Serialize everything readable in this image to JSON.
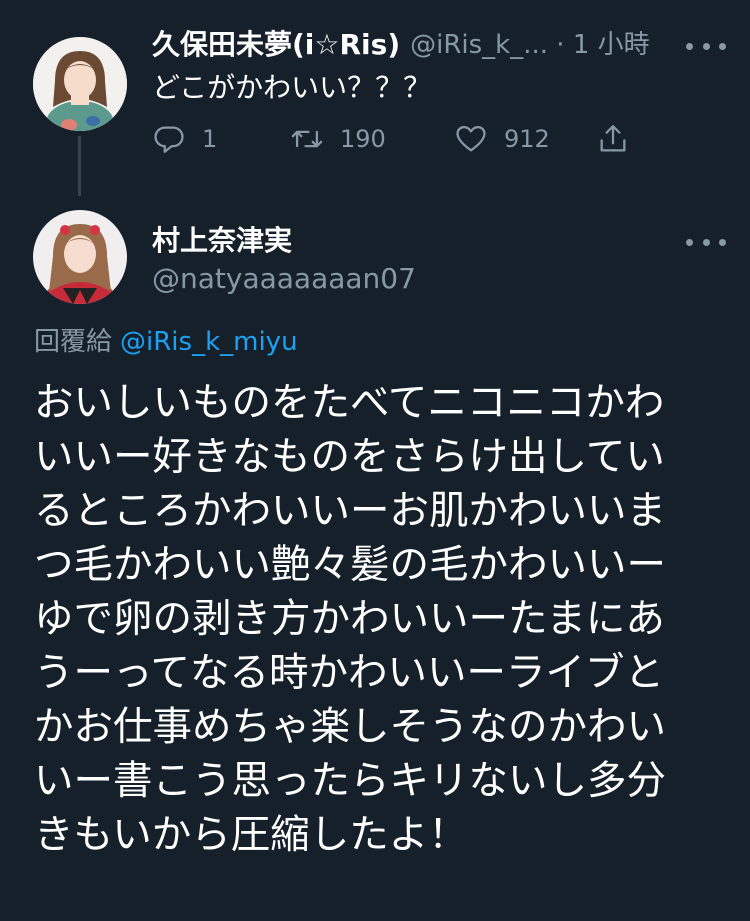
{
  "tweet1": {
    "display_name": "久保田未夢(i☆Ris)",
    "handle_time": "@iRis_k_... · 1 小時",
    "text": "どこがかわいい？？？",
    "replies": "1",
    "retweets": "190",
    "likes": "912",
    "icons": {
      "reply": "reply-icon",
      "retweet": "retweet-icon",
      "like": "heart-icon",
      "share": "share-icon",
      "more": "more-icon"
    }
  },
  "tweet2": {
    "display_name": "村上奈津実",
    "handle": "@natyaaaaaaan07",
    "reply_prefix": "回覆給",
    "reply_to": "@iRis_k_miyu",
    "body_lines": [
      "おいしいものをたべてニコニコかわ",
      "いいー好きなものをさらけ出してい",
      "るところかわいいーお肌かわいいま",
      "つ毛かわいい艶々髪の毛かわいいー",
      "ゆで卵の剥き方かわいいーたまにあ",
      "うーってなる時かわいいーライブと",
      "かお仕事めちゃ楽しそうなのかわい",
      "いー書こう思ったらキリないし多分",
      "きもいから圧縮したよ！"
    ]
  },
  "colors": {
    "background": "#15202b",
    "text": "#ffffff",
    "muted": "#8899a6",
    "link": "#1da1f2",
    "thread_line": "#38444d"
  }
}
